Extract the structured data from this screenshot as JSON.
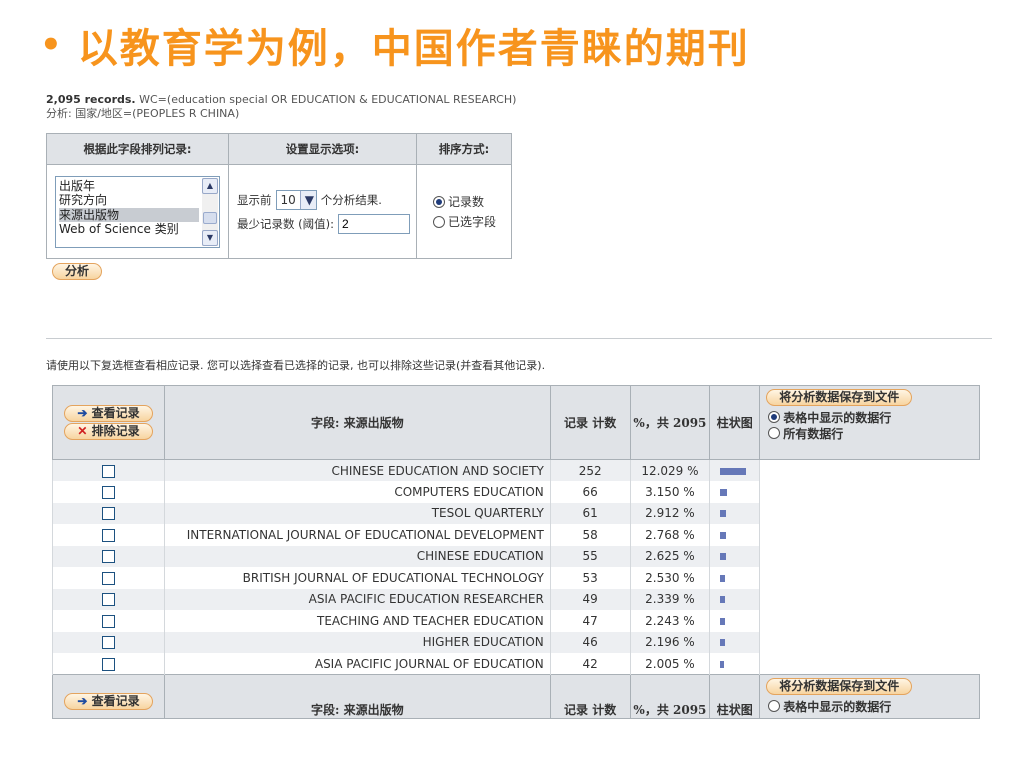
{
  "slide": {
    "bullet": "•",
    "title": "以教育学为例，中国作者青睐的期刊"
  },
  "query": {
    "records": "2,095 records.",
    "wc": "WC=(education special OR EDUCATION & EDUCATIONAL RESEARCH)",
    "analysis": "分析: 国家/地区=(PEOPLES R CHINA)"
  },
  "options": {
    "headers": [
      "根据此字段排列记录:",
      "设置显示选项:",
      "排序方式:"
    ],
    "fields": [
      "出版年",
      "研究方向",
      "来源出版物",
      "Web of Science 类别"
    ],
    "selected_field": "来源出版物",
    "show_prefix": "显示前",
    "show_count": "10",
    "show_suffix": "个分析结果.",
    "min_label": "最少记录数 (阈值):",
    "min_value": "2",
    "sort_options": [
      "记录数",
      "已选字段"
    ],
    "sort_selected": "记录数",
    "analyze": "分析"
  },
  "instruction": "请使用以下复选框查看相应记录. 您可以选择查看已选择的记录, 也可以排除这些记录(并查看其他记录).",
  "results": {
    "view_button": "查看记录",
    "exclude_button": "排除记录",
    "col_field": "字段: 来源出版物",
    "col_count": "记录 计数",
    "col_pct": "%，共 2095",
    "col_bar": "柱状图",
    "save_button": "将分析数据保存到文件",
    "save_options": [
      "表格中显示的数据行",
      "所有数据行"
    ],
    "save_selected": "表格中显示的数据行",
    "rows": [
      {
        "name": "CHINESE EDUCATION AND SOCIETY",
        "count": "252",
        "pct": "12.029 %",
        "value": 252
      },
      {
        "name": "COMPUTERS EDUCATION",
        "count": "66",
        "pct": "3.150 %",
        "value": 66
      },
      {
        "name": "TESOL QUARTERLY",
        "count": "61",
        "pct": "2.912 %",
        "value": 61
      },
      {
        "name": "INTERNATIONAL JOURNAL OF EDUCATIONAL DEVELOPMENT",
        "count": "58",
        "pct": "2.768 %",
        "value": 58
      },
      {
        "name": "CHINESE EDUCATION",
        "count": "55",
        "pct": "2.625 %",
        "value": 55
      },
      {
        "name": "BRITISH JOURNAL OF EDUCATIONAL TECHNOLOGY",
        "count": "53",
        "pct": "2.530 %",
        "value": 53
      },
      {
        "name": "ASIA PACIFIC EDUCATION RESEARCHER",
        "count": "49",
        "pct": "2.339 %",
        "value": 49
      },
      {
        "name": "TEACHING AND TEACHER EDUCATION",
        "count": "47",
        "pct": "2.243 %",
        "value": 47
      },
      {
        "name": "HIGHER EDUCATION",
        "count": "46",
        "pct": "2.196 %",
        "value": 46
      },
      {
        "name": "ASIA PACIFIC JOURNAL OF EDUCATION",
        "count": "42",
        "pct": "2.005 %",
        "value": 42
      }
    ]
  },
  "colors": {
    "title": "#F7941D",
    "bar": "#6678B8",
    "header_bg": "#E0E3E7",
    "row_alt": "#EDEFF2"
  }
}
